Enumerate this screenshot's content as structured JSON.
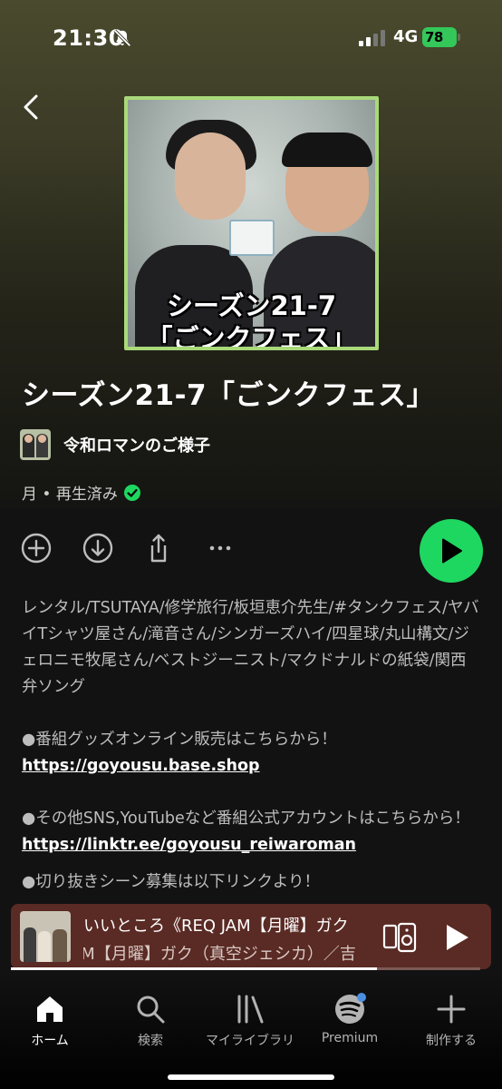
{
  "status": {
    "time": "21:30",
    "network": "4G",
    "battery": "78"
  },
  "cover": {
    "line1": "シーズン21-7",
    "line2": "「ごンクフェス」"
  },
  "episode": {
    "title": "シーズン21-7「ごンクフェス」"
  },
  "show": {
    "name": "令和ロマンのご様子"
  },
  "meta": {
    "text": "月 • 再生済み"
  },
  "description": {
    "topics": "レンタル/TSUTAYA/修学旅行/板垣恵介先生/#タンクフェス/ヤバイTシャツ屋さん/滝音さん/シンガーズハイ/四星球/丸山構文/ジェロニモ牧尾さん/ベストジーニスト/マクドナルドの紙袋/関西弁ソング",
    "goods_text": "●番組グッズオンライン販売はこちらから！",
    "goods_link": "https://goyousu.base.shop",
    "sns_text": "●その他SNS,YouTubeなど番組公式アカウントはこちらから！",
    "sns_link": "https://linktr.ee/goyousu_reiwaroman",
    "clip_text": "●切り抜きシーン募集は以下リンクより！"
  },
  "mini_player": {
    "line1": "いいところ《REQ JAM【月曜】ガク",
    "line2": "JAM【月曜】ガク（真空ジェシカ）／吉",
    "progress": 0.78
  },
  "tabs": [
    {
      "label": "ホーム",
      "icon": "home-icon"
    },
    {
      "label": "検索",
      "icon": "search-icon"
    },
    {
      "label": "マイライブラリ",
      "icon": "library-icon"
    },
    {
      "label": "Premium",
      "icon": "spotify-icon"
    },
    {
      "label": "制作する",
      "icon": "plus-icon"
    }
  ],
  "colors": {
    "accent": "#1ed760",
    "cover_border": "#a9d97a",
    "mini_player_bg": "#5a2a24"
  }
}
